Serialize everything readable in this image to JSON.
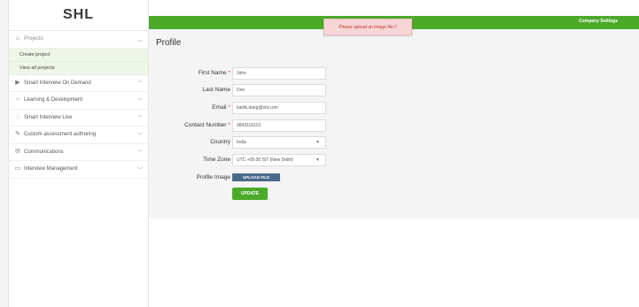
{
  "brand": {
    "logo_text": "SHL"
  },
  "sidebar": {
    "projects_header": "Projects",
    "sub_items": [
      {
        "label": "Create project"
      },
      {
        "label": "View all projects"
      }
    ],
    "items": [
      {
        "label": "Smart Interview On Demand",
        "icon": "video-icon"
      },
      {
        "label": "Learning & Development",
        "icon": "lightbulb-icon"
      },
      {
        "label": "Smart Interview Live",
        "icon": "chat-icon"
      },
      {
        "label": "Custom assessment authoring",
        "icon": "pencil-icon"
      },
      {
        "label": "Communications",
        "icon": "mail-icon"
      },
      {
        "label": "Interview Management",
        "icon": "clipboard-icon"
      }
    ]
  },
  "topbar": {
    "settings_label": "Company Settings",
    "color": "#4caa2a"
  },
  "toast": {
    "message": "Please upload an image file !!"
  },
  "profile": {
    "title": "Profile",
    "fields": {
      "first_name": {
        "label": "First Name",
        "value": "John",
        "required": "*"
      },
      "last_name": {
        "label": "Last Name",
        "value": "Doe"
      },
      "email": {
        "label": "Email",
        "value": "kartik.dang@shl.com",
        "required": "*"
      },
      "contact_number": {
        "label": "Contact Number",
        "value": "9843116113",
        "required": "*"
      },
      "country": {
        "label": "Country",
        "value": "India"
      },
      "time_zone": {
        "label": "Time Zone",
        "value": "UTC +05:30 IST (New Delhi)"
      },
      "profile_image": {
        "label": "Profile Image"
      }
    },
    "upload_label": "UPLOAD FILE",
    "update_label": "UPDATE"
  }
}
